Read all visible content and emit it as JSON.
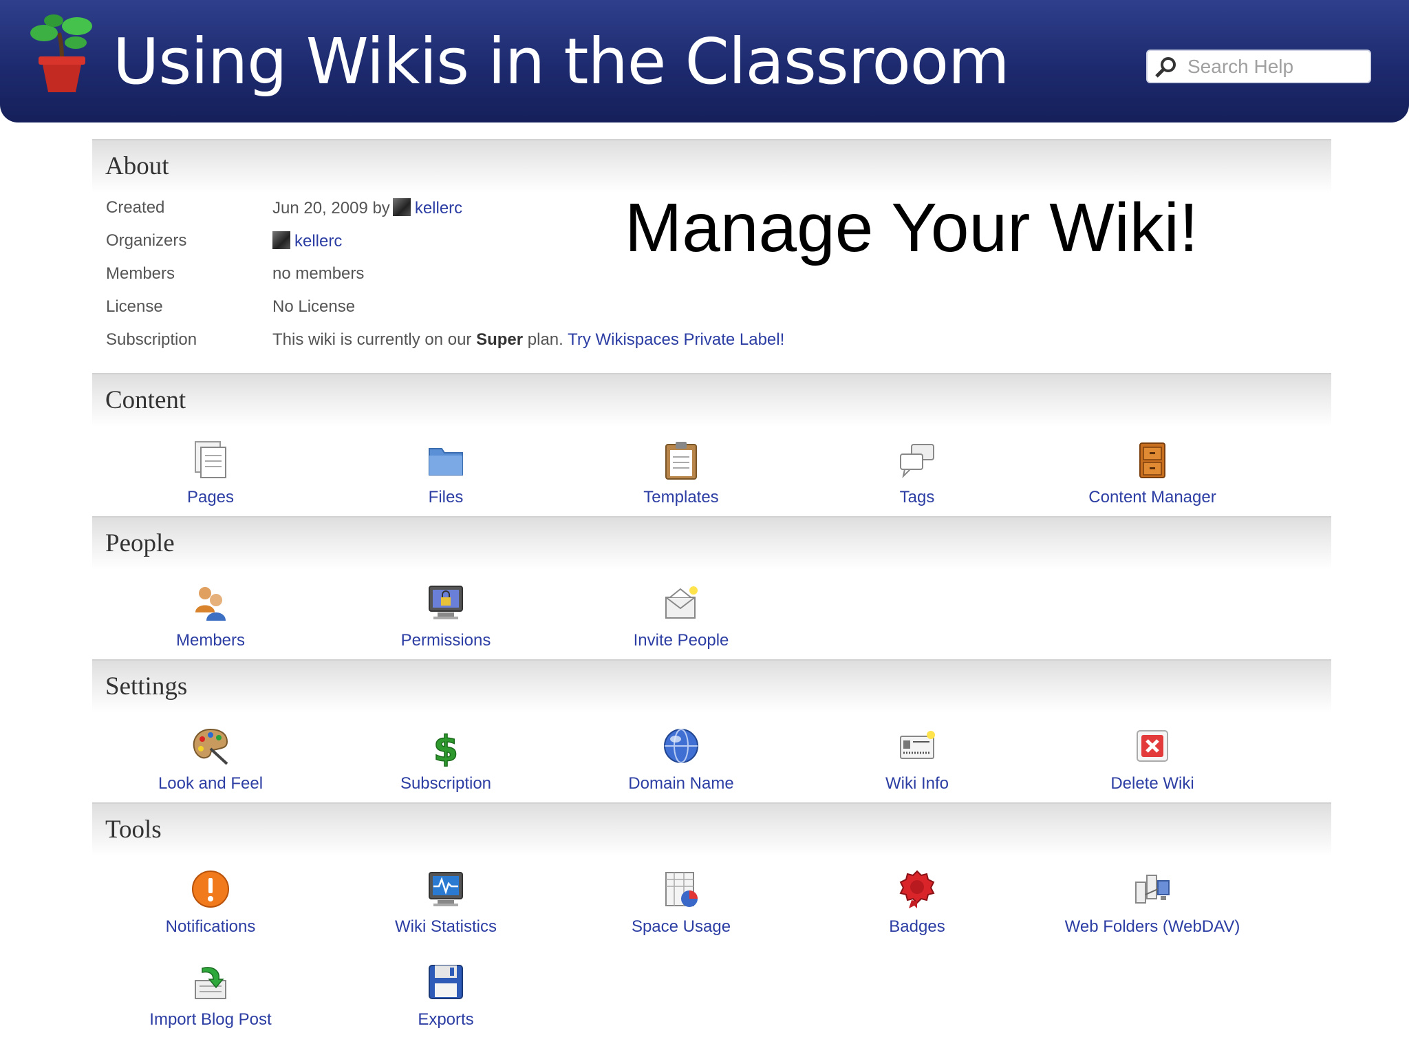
{
  "banner": {
    "title": "Using Wikis in the Classroom",
    "search_placeholder": "Search Help"
  },
  "headline": "Manage Your Wiki!",
  "about": {
    "heading": "About",
    "rows": [
      {
        "label": "Created",
        "date": "Jun 20, 2009 by",
        "user": "kellerc"
      },
      {
        "label": "Organizers",
        "user": "kellerc"
      },
      {
        "label": "Members",
        "value": "no members"
      },
      {
        "label": "License",
        "value": "No License"
      },
      {
        "label": "Subscription",
        "pre": "This wiki is currently on our",
        "plan": "Super",
        "post": "plan.",
        "link": "Try Wikispaces Private Label!"
      }
    ]
  },
  "sections": {
    "content": {
      "heading": "Content",
      "items": [
        "Pages",
        "Files",
        "Templates",
        "Tags",
        "Content Manager"
      ]
    },
    "people": {
      "heading": "People",
      "items": [
        "Members",
        "Permissions",
        "Invite People"
      ]
    },
    "settings": {
      "heading": "Settings",
      "items": [
        "Look and Feel",
        "Subscription",
        "Domain Name",
        "Wiki Info",
        "Delete Wiki"
      ]
    },
    "tools": {
      "heading": "Tools",
      "items": [
        "Notifications",
        "Wiki Statistics",
        "Space Usage",
        "Badges",
        "Web Folders (WebDAV)",
        "Import Blog Post",
        "Exports"
      ]
    }
  },
  "colors": {
    "banner": "#1d2a6e",
    "link": "#2c3ea3",
    "section_header": "#e4e4e4"
  }
}
